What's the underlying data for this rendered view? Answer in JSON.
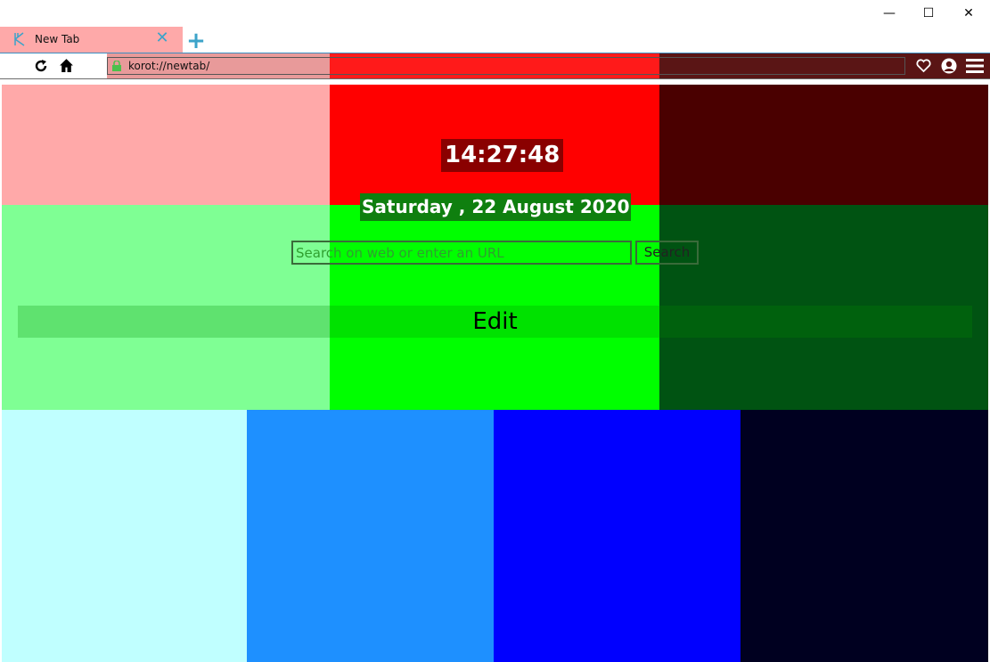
{
  "window": {
    "minimize_glyph": "—",
    "maximize_glyph": "☐",
    "close_glyph": "✕"
  },
  "tab": {
    "title": "New Tab",
    "close_glyph": "✕",
    "new_tab_glyph": "+"
  },
  "toolbar": {
    "reload_icon": "reload-icon",
    "home_icon": "home-icon",
    "url": "korot://newtab/",
    "favorites_icon": "heart-icon",
    "profile_icon": "user-icon",
    "menu_icon": "hamburger-menu-icon"
  },
  "newtab": {
    "time": "14:27:48",
    "date": "Saturday , 22 August 2020",
    "search_placeholder": "Search on web or enter an URL",
    "search_button": "Search",
    "edit_label": "Edit"
  },
  "colors": {
    "tab_bg": "#fea9a9",
    "accent": "#3ca3c9",
    "row1": [
      "#ffa9a9",
      "#ff0000",
      "#4a0000"
    ],
    "row2": [
      "#7fff94",
      "#00ff00",
      "#005312"
    ],
    "row3": [
      "#c0ffff",
      "#1e90ff",
      "#0000ff",
      "#000020"
    ]
  }
}
